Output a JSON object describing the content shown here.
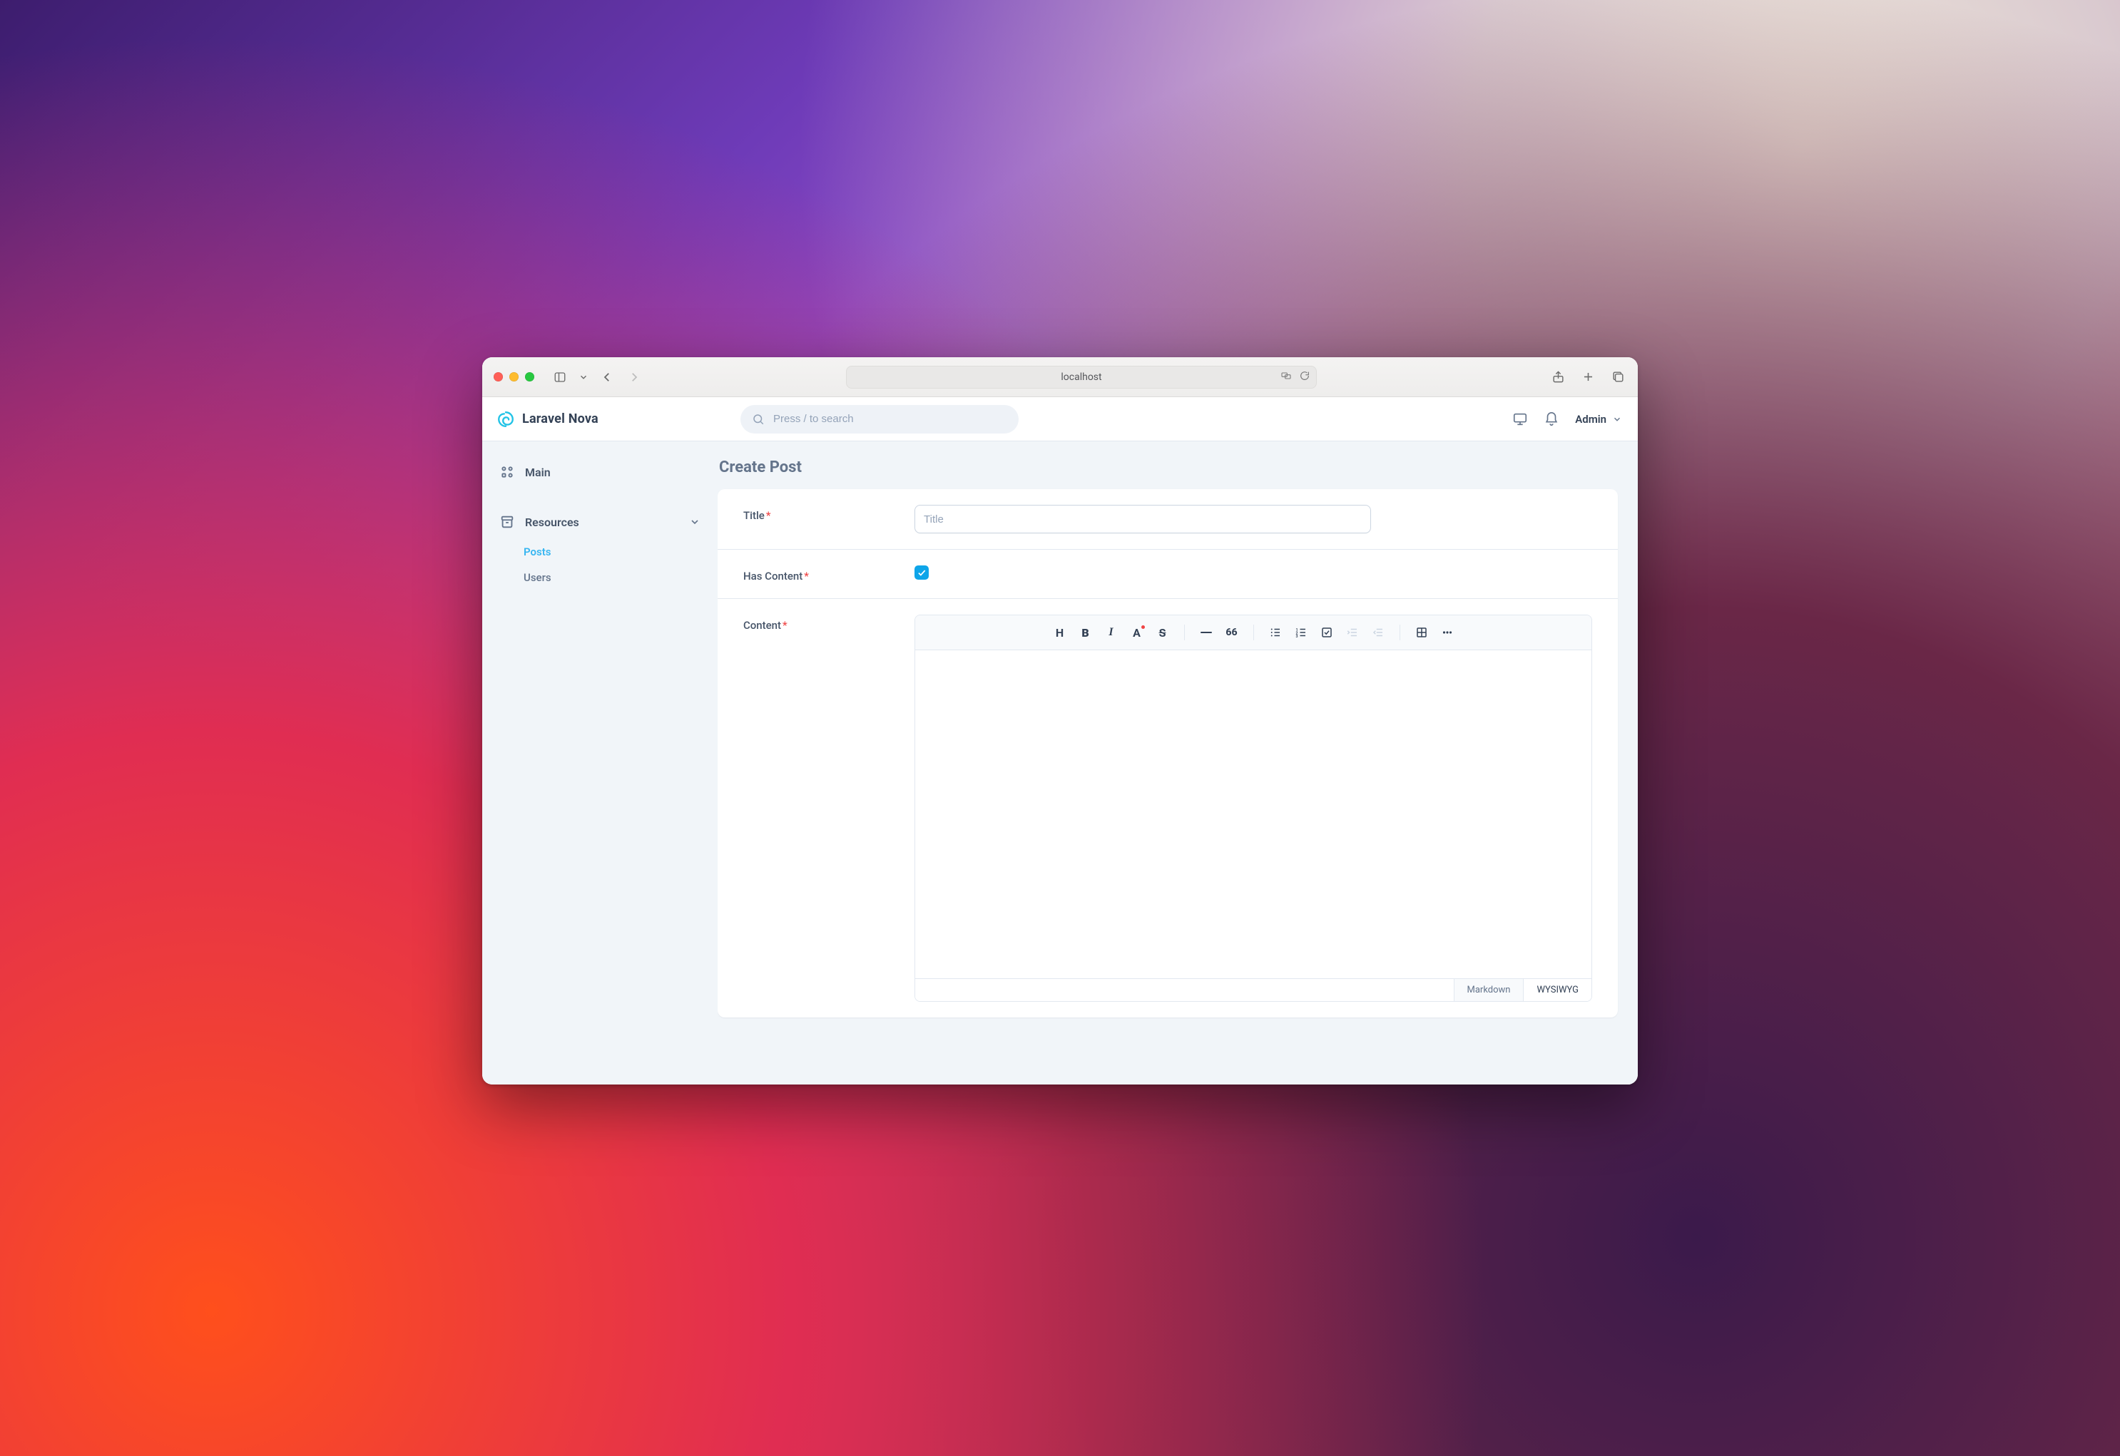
{
  "browser": {
    "address": "localhost"
  },
  "app": {
    "brand": "Laravel Nova",
    "search_placeholder": "Press / to search",
    "user_label": "Admin"
  },
  "sidebar": {
    "main_label": "Main",
    "resources_label": "Resources",
    "items": [
      {
        "label": "Posts",
        "active": true
      },
      {
        "label": "Users",
        "active": false
      }
    ]
  },
  "page": {
    "title": "Create Post",
    "fields": {
      "title": {
        "label": "Title",
        "required": true,
        "placeholder": "Title",
        "value": ""
      },
      "has_content": {
        "label": "Has Content",
        "required": true,
        "checked": true
      },
      "content": {
        "label": "Content",
        "required": true
      }
    },
    "editor": {
      "toolbar": {
        "heading": "H",
        "bold": "B",
        "italic": "I",
        "font_color": "A",
        "strike": "S",
        "quote": "66"
      },
      "tabs": {
        "markdown": "Markdown",
        "wysiwyg": "WYSIWYG"
      }
    }
  }
}
